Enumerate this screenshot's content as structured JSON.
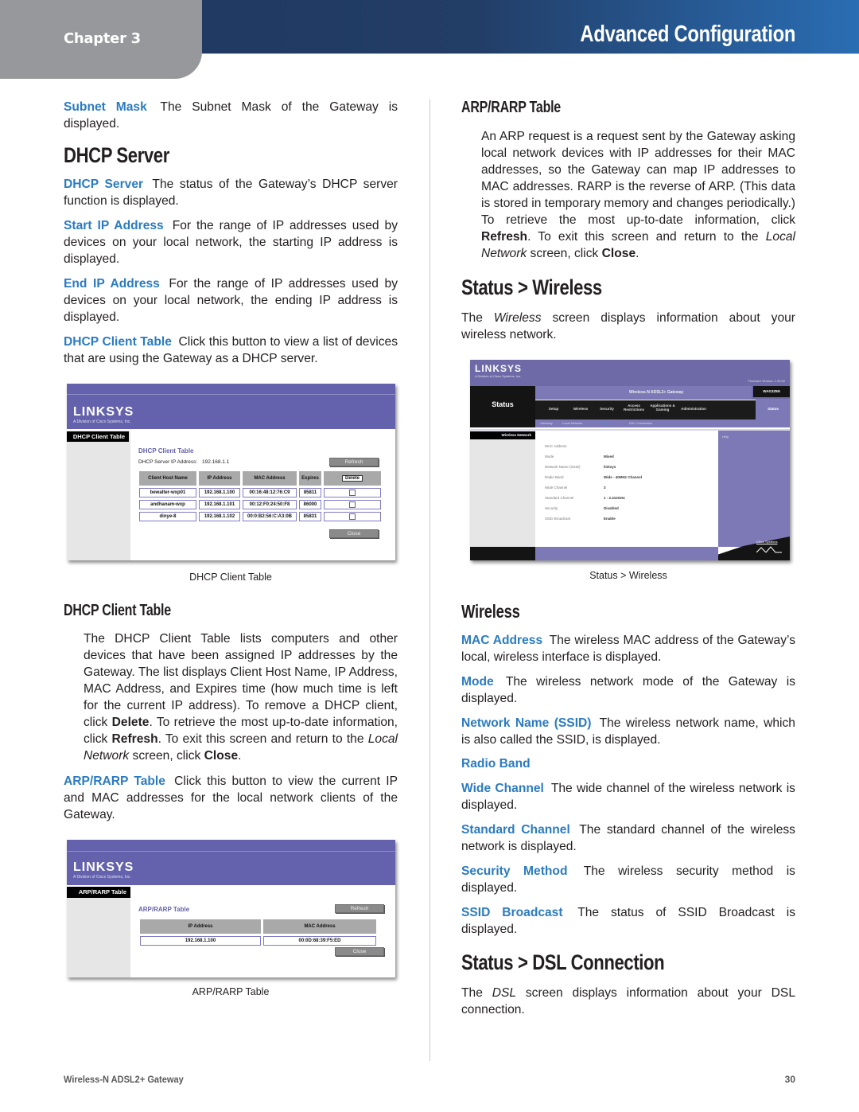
{
  "header": {
    "chapter": "Chapter 3",
    "section": "Advanced Configuration"
  },
  "left": {
    "subnet_mask": {
      "term": "Subnet Mask",
      "text": "The Subnet Mask of the Gateway is displayed."
    },
    "dhcp_heading": "DHCP Server",
    "dhcp_server": {
      "term": "DHCP Server",
      "text": "The status of the Gateway’s DHCP server function is displayed."
    },
    "start_ip": {
      "term": "Start IP Address",
      "text": "For the range of IP addresses used by devices on your local network, the starting IP address is displayed."
    },
    "end_ip": {
      "term": "End IP Address",
      "text": "For the range of IP addresses used by devices on your local network, the ending IP address is displayed."
    },
    "dhcp_client": {
      "term": "DHCP Client Table",
      "text": "Click this button to view a list of devices that are using the Gateway as a DHCP server."
    },
    "dhcp_figure": {
      "caption": "DHCP Client Table",
      "logo": "LINKSYS",
      "logo_sub": "A Division of Cisco Systems, Inc.",
      "side_label": "DHCP Client Table",
      "title": "DHCP Client Table",
      "server_ip_label": "DHCP Server IP Address:",
      "server_ip_value": "192.168.1.1",
      "refresh": "Refresh",
      "close": "Close",
      "delete": "Delete",
      "columns": [
        "Client Host Name",
        "IP Address",
        "MAC Address",
        "Expires"
      ],
      "rows": [
        [
          "bewalter-wxp01",
          "192.168.1.100",
          "00:16:48:12:76:C9",
          "85811"
        ],
        [
          "andhanam-wxp",
          "192.168.1.101",
          "00:12:F0:24:50:F8",
          "86000"
        ],
        [
          "dinye-8",
          "192.168.1.102",
          "00:0:B2:56:C:A3:0B",
          "85831"
        ]
      ]
    },
    "client_table_heading": "DHCP Client Table",
    "client_table_text": {
      "p1": "The DHCP Client Table lists computers and other devices that have been assigned IP addresses by the Gateway. The list displays Client Host Name, IP Address, MAC Address, and Expires time (how much time is left for the current IP address). To remove a DHCP client, click ",
      "delete": "Delete",
      "p2": ". To retrieve the most up-to-date information, click ",
      "refresh": "Refresh",
      "p3": ". To exit this screen and return to the ",
      "local_network": "Local Network",
      "p4": " screen, click ",
      "close": "Close",
      "p5": "."
    },
    "arp_button": {
      "term": "ARP/RARP Table",
      "text": "Click this button to view the current IP and MAC addresses for the local network clients of the Gateway."
    },
    "arp_figure": {
      "caption": "ARP/RARP Table",
      "logo": "LINKSYS",
      "logo_sub": "A Division of Cisco Systems, Inc.",
      "side_label": "ARP/RARP Table",
      "title": "ARP/RARP Table",
      "refresh": "Refresh",
      "close": "Close",
      "columns": [
        "IP Address",
        "MAC Address"
      ],
      "rows": [
        [
          "192.168.1.100",
          "00:0D:68:39:F5:ED"
        ]
      ]
    }
  },
  "right": {
    "arp_heading": "ARP/RARP Table",
    "arp_text": {
      "p1": "An ARP request is a request sent by the Gateway asking local network devices with IP addresses for their MAC addresses, so the Gateway can map IP addresses to MAC addresses. RARP is the reverse of ARP. (This data is stored in temporary memory and changes periodically.) To retrieve the most up-to-date information, click ",
      "refresh": "Refresh",
      "p2": ". To exit this screen and return to the ",
      "local_network": "Local Network",
      "p3": " screen, click ",
      "close": "Close",
      "p4": "."
    },
    "status_wireless_heading": "Status > Wireless",
    "status_wireless_text": {
      "p1": "The ",
      "em": "Wireless",
      "p2": " screen displays information about your wireless network."
    },
    "wireless_figure": {
      "caption": "Status > Wireless",
      "logo": "LINKSYS",
      "logo_sub": "A Division of Cisco Systems, Inc.",
      "firmware": "Firmware Version: 1.00.00",
      "page": "Status",
      "product": "Wireless-N ADSL2+ Gateway",
      "model": "WAG325N",
      "tabs": [
        "Setup",
        "Wireless",
        "Security",
        "Access Restrictions",
        "Applications & Gaming",
        "Administration",
        "Status"
      ],
      "subtabs": [
        "Gateway",
        "Local Network",
        "Wireless",
        "DSL Connection"
      ],
      "side_label": "Wireless Network",
      "help": "Help",
      "fields": [
        {
          "label": "MAC Address",
          "value": ""
        },
        {
          "label": "Mode",
          "value": "Mixed"
        },
        {
          "label": "Network Name (SSID)",
          "value": "linksys"
        },
        {
          "label": "Radio Band",
          "value": "Wide - 40MHz Channel"
        },
        {
          "label": "Wide Channel",
          "value": "3"
        },
        {
          "label": "Standard Channel",
          "value": "1 - 2.412GHz"
        },
        {
          "label": "Security",
          "value": "Disabled"
        },
        {
          "label": "SSID Broadcast",
          "value": "Enable"
        }
      ],
      "brand": "Cisco Systems"
    },
    "wireless_heading": "Wireless",
    "items": [
      {
        "term": "MAC Address",
        "text": "The wireless MAC address of the Gateway’s local, wireless interface is displayed."
      },
      {
        "term": "Mode",
        "text": "The wireless network mode of the Gateway is displayed."
      },
      {
        "term": "Network Name (SSID)",
        "text": "The wireless network name, which is also called the SSID, is displayed."
      },
      {
        "term": "Radio Band",
        "text": ""
      },
      {
        "term": "Wide Channel",
        "text": "The wide channel of the wireless network is displayed."
      },
      {
        "term": "Standard Channel",
        "text": "The standard channel of the wireless network is displayed."
      },
      {
        "term": "Security Method",
        "text": "The wireless security method is displayed."
      },
      {
        "term": "SSID Broadcast",
        "text": "The status of SSID Broadcast is displayed."
      }
    ],
    "dsl_heading": "Status > DSL Connection",
    "dsl_text": {
      "p1": "The ",
      "em": "DSL",
      "p2": " screen displays information about your DSL connection."
    }
  },
  "footer": {
    "product": "Wireless-N ADSL2+ Gateway",
    "page_number": "30"
  }
}
